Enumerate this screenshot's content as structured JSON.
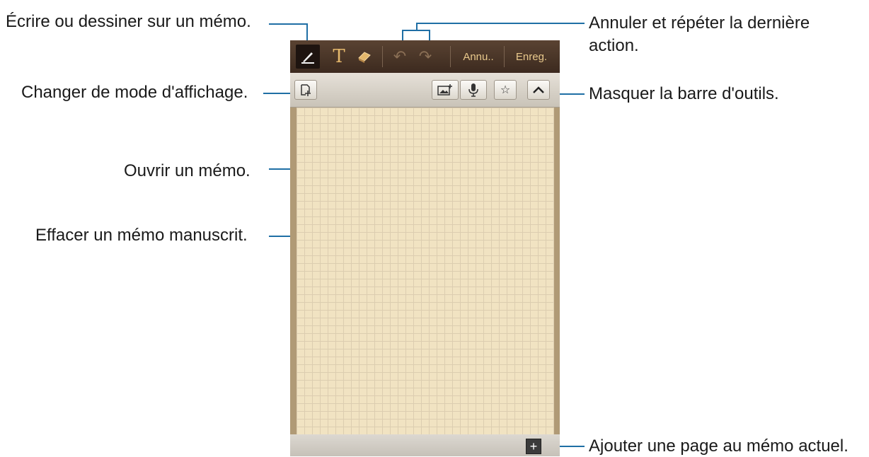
{
  "callouts": {
    "write": "Écrire ou dessiner sur un mémo.",
    "view_mode": "Changer de mode d'affichage.",
    "open": "Ouvrir un mémo.",
    "erase": "Effacer un mémo manuscrit.",
    "undo_redo_1": "Annuler et répéter la dernière",
    "undo_redo_2": "action.",
    "hide_toolbar": "Masquer la barre d'outils.",
    "add_page": "Ajouter une page au mémo actuel."
  },
  "topbar": {
    "text_glyph": "T",
    "undo_glyph": "↶",
    "redo_glyph": "↷",
    "cancel_label": "Annu..",
    "save_label": "Enreg."
  },
  "toolbar": {
    "image_glyph": "🖼",
    "mic_glyph": "🎙",
    "star_glyph": "☆",
    "hide_glyph": "⌃"
  },
  "bottombar": {
    "add_page_glyph": "+"
  },
  "colors": {
    "callout_line": "#1f6fa5",
    "paper": "#f1e3c2",
    "topbar": "#3c2a1f"
  }
}
